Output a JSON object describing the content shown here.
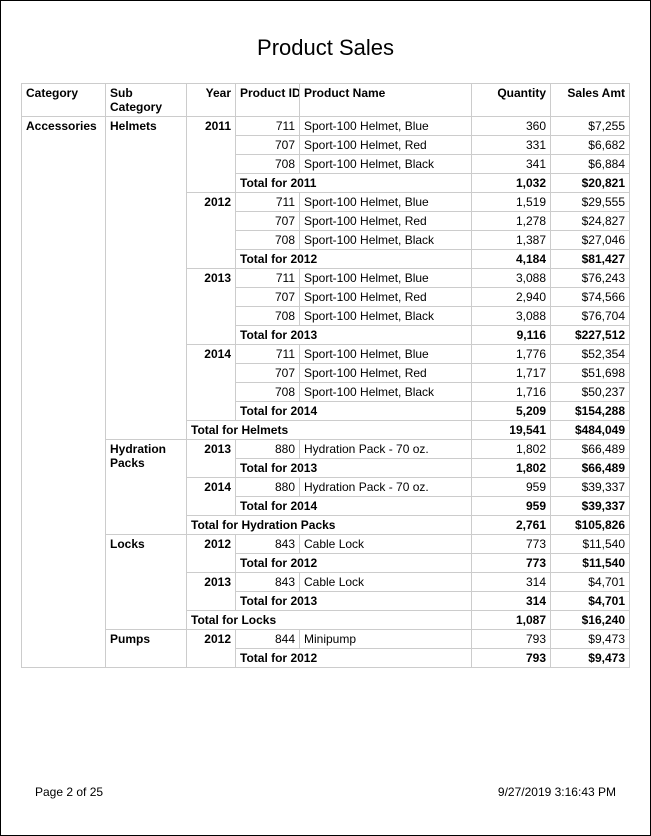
{
  "title": "Product Sales",
  "headers": {
    "category": "Category",
    "subcategory": "Sub Category",
    "year": "Year",
    "product_id": "Product ID",
    "product_name": "Product Name",
    "quantity": "Quantity",
    "sales_amt": "Sales Amt"
  },
  "category": "Accessories",
  "groups": [
    {
      "sub": "Helmets",
      "years": [
        {
          "year": "2011",
          "rows": [
            {
              "pid": "711",
              "name": "Sport-100 Helmet, Blue",
              "qty": "360",
              "amt": "$7,255"
            },
            {
              "pid": "707",
              "name": "Sport-100 Helmet, Red",
              "qty": "331",
              "amt": "$6,682"
            },
            {
              "pid": "708",
              "name": "Sport-100 Helmet, Black",
              "qty": "341",
              "amt": "$6,884"
            }
          ],
          "total": {
            "label": "Total for 2011",
            "qty": "1,032",
            "amt": "$20,821"
          }
        },
        {
          "year": "2012",
          "rows": [
            {
              "pid": "711",
              "name": "Sport-100 Helmet, Blue",
              "qty": "1,519",
              "amt": "$29,555"
            },
            {
              "pid": "707",
              "name": "Sport-100 Helmet, Red",
              "qty": "1,278",
              "amt": "$24,827"
            },
            {
              "pid": "708",
              "name": "Sport-100 Helmet, Black",
              "qty": "1,387",
              "amt": "$27,046"
            }
          ],
          "total": {
            "label": "Total for 2012",
            "qty": "4,184",
            "amt": "$81,427"
          }
        },
        {
          "year": "2013",
          "rows": [
            {
              "pid": "711",
              "name": "Sport-100 Helmet, Blue",
              "qty": "3,088",
              "amt": "$76,243"
            },
            {
              "pid": "707",
              "name": "Sport-100 Helmet, Red",
              "qty": "2,940",
              "amt": "$74,566"
            },
            {
              "pid": "708",
              "name": "Sport-100 Helmet, Black",
              "qty": "3,088",
              "amt": "$76,704"
            }
          ],
          "total": {
            "label": "Total for 2013",
            "qty": "9,116",
            "amt": "$227,512"
          }
        },
        {
          "year": "2014",
          "rows": [
            {
              "pid": "711",
              "name": "Sport-100 Helmet, Blue",
              "qty": "1,776",
              "amt": "$52,354"
            },
            {
              "pid": "707",
              "name": "Sport-100 Helmet, Red",
              "qty": "1,717",
              "amt": "$51,698"
            },
            {
              "pid": "708",
              "name": "Sport-100 Helmet, Black",
              "qty": "1,716",
              "amt": "$50,237"
            }
          ],
          "total": {
            "label": "Total for 2014",
            "qty": "5,209",
            "amt": "$154,288"
          }
        }
      ],
      "subtotal": {
        "label": "Total for Helmets",
        "qty": "19,541",
        "amt": "$484,049"
      }
    },
    {
      "sub": "Hydration Packs",
      "years": [
        {
          "year": "2013",
          "rows": [
            {
              "pid": "880",
              "name": "Hydration Pack - 70 oz.",
              "qty": "1,802",
              "amt": "$66,489"
            }
          ],
          "total": {
            "label": "Total for 2013",
            "qty": "1,802",
            "amt": "$66,489"
          }
        },
        {
          "year": "2014",
          "rows": [
            {
              "pid": "880",
              "name": "Hydration Pack - 70 oz.",
              "qty": "959",
              "amt": "$39,337"
            }
          ],
          "total": {
            "label": "Total for 2014",
            "qty": "959",
            "amt": "$39,337"
          }
        }
      ],
      "subtotal": {
        "label": "Total for Hydration Packs",
        "qty": "2,761",
        "amt": "$105,826"
      }
    },
    {
      "sub": "Locks",
      "years": [
        {
          "year": "2012",
          "rows": [
            {
              "pid": "843",
              "name": "Cable Lock",
              "qty": "773",
              "amt": "$11,540"
            }
          ],
          "total": {
            "label": "Total for 2012",
            "qty": "773",
            "amt": "$11,540"
          }
        },
        {
          "year": "2013",
          "rows": [
            {
              "pid": "843",
              "name": "Cable Lock",
              "qty": "314",
              "amt": "$4,701"
            }
          ],
          "total": {
            "label": "Total for 2013",
            "qty": "314",
            "amt": "$4,701"
          }
        }
      ],
      "subtotal": {
        "label": "Total for Locks",
        "qty": "1,087",
        "amt": "$16,240"
      }
    },
    {
      "sub": "Pumps",
      "years": [
        {
          "year": "2012",
          "rows": [
            {
              "pid": "844",
              "name": "Minipump",
              "qty": "793",
              "amt": "$9,473"
            }
          ],
          "total": {
            "label": "Total for 2012",
            "qty": "793",
            "amt": "$9,473"
          }
        }
      ]
    }
  ],
  "footer": {
    "page": "Page 2 of 25",
    "timestamp": "9/27/2019 3:16:43 PM"
  }
}
